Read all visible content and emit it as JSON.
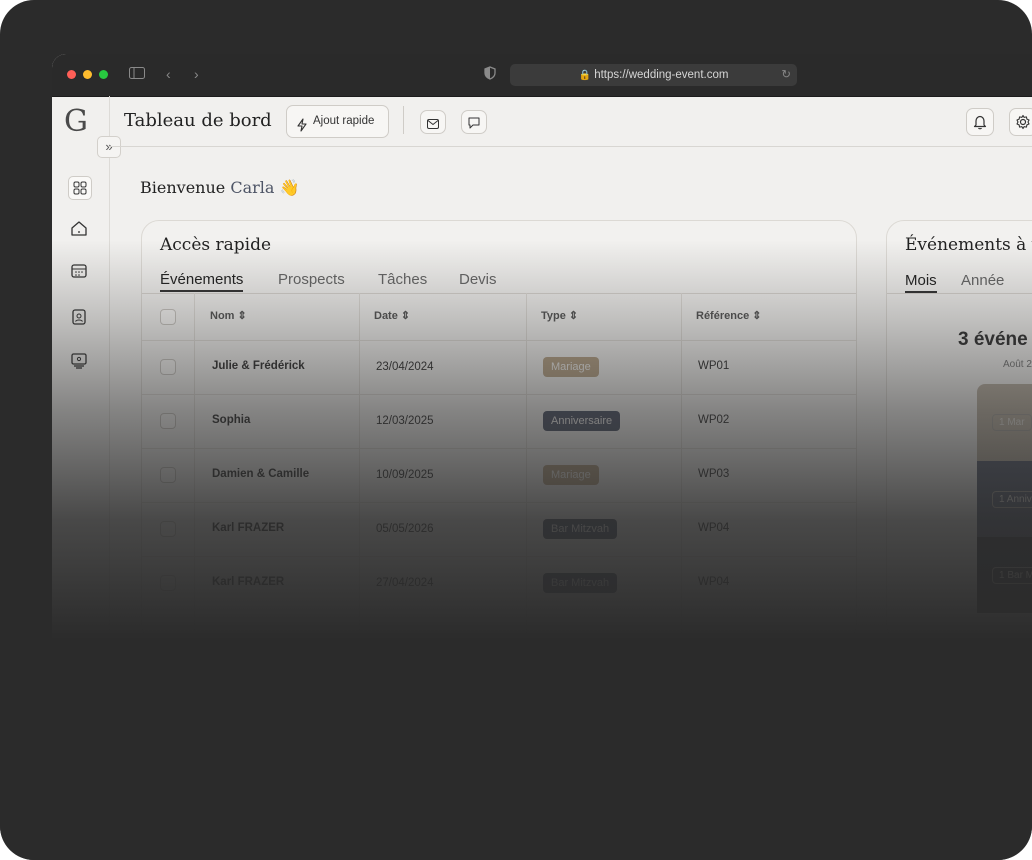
{
  "browser": {
    "url": "https://wedding-event.com",
    "traffic_colors": [
      "#ff5f57",
      "#febc2e",
      "#28c840"
    ]
  },
  "app": {
    "logo_letter": "G",
    "expand_glyph": "»",
    "header": {
      "title": "Tableau de bord",
      "quick_add_label": "Ajout rapide"
    },
    "welcome": {
      "prefix": "Bienvenue",
      "name": "Carla",
      "emoji": "👋"
    },
    "quick_access": {
      "title": "Accès rapide",
      "tabs": [
        "Événements",
        "Prospects",
        "Tâches",
        "Devis"
      ],
      "active_tab": "Événements",
      "columns": [
        "Nom",
        "Date",
        "Type",
        "Référence"
      ],
      "rows": [
        {
          "name": "Julie & Frédérick",
          "date": "23/04/2024",
          "type": "Mariage",
          "ref": "WP01"
        },
        {
          "name": "Sophia",
          "date": "12/03/2025",
          "type": "Anniversaire",
          "ref": "WP02"
        },
        {
          "name": "Damien & Camille",
          "date": "10/09/2025",
          "type": "Mariage",
          "ref": "WP03"
        },
        {
          "name": "Karl FRAZER",
          "date": "05/05/2026",
          "type": "Bar Mitzvah",
          "ref": "WP04"
        },
        {
          "name": "Karl FRAZER",
          "date": "27/04/2024",
          "type": "Bar Mitzvah",
          "ref": "WP04"
        }
      ]
    },
    "upcoming": {
      "title": "Événements à v",
      "tabs": [
        "Mois",
        "Année"
      ],
      "active_tab": "Mois",
      "count_text": "3 événe",
      "month_text": "Août 2",
      "strip_labels": [
        "1 Mar",
        "1 Anniv",
        "1 Bar M"
      ]
    },
    "colors": {
      "mariage_badge": "#b8a488",
      "anniversaire_badge": "#52596b",
      "accent_name": "#4e5566"
    }
  }
}
